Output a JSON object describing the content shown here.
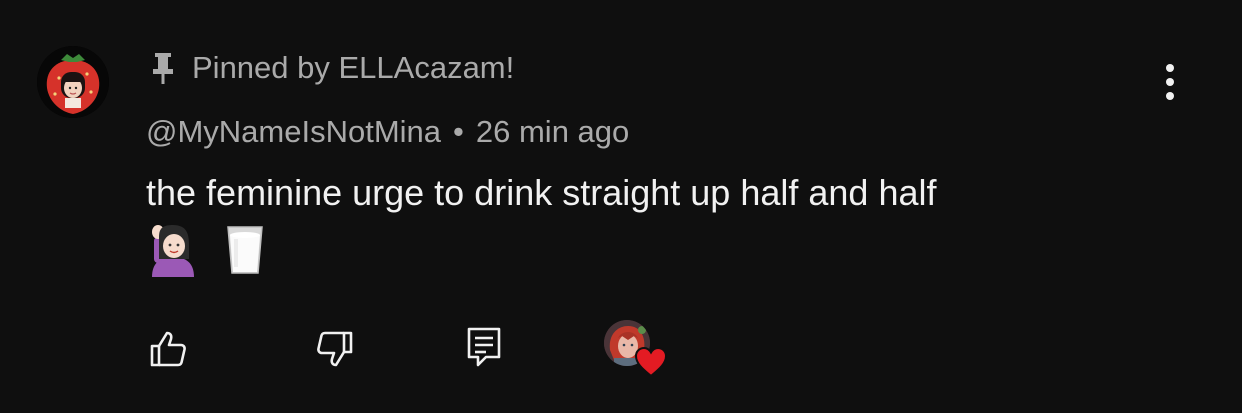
{
  "comment": {
    "pinned_label": "Pinned by ELLAcazam!",
    "author_handle": "@MyNameIsNotMina",
    "separator": "•",
    "timestamp": "26 min ago",
    "text": "the feminine urge to drink straight up half and half",
    "emojis": [
      "raising-hand-woman-emoji",
      "glass-of-milk-emoji"
    ]
  },
  "icons": {
    "pin": "pin-icon",
    "menu": "more-vertical-icon",
    "like": "thumbs-up-icon",
    "dislike": "thumbs-down-icon",
    "reply": "reply-comment-icon",
    "creator_heart": "creator-heart-icon"
  },
  "colors": {
    "background": "#0f0f0f",
    "primary_text": "#f1f1f1",
    "secondary_text": "#aaaaaa",
    "heart": "#e31b23"
  }
}
